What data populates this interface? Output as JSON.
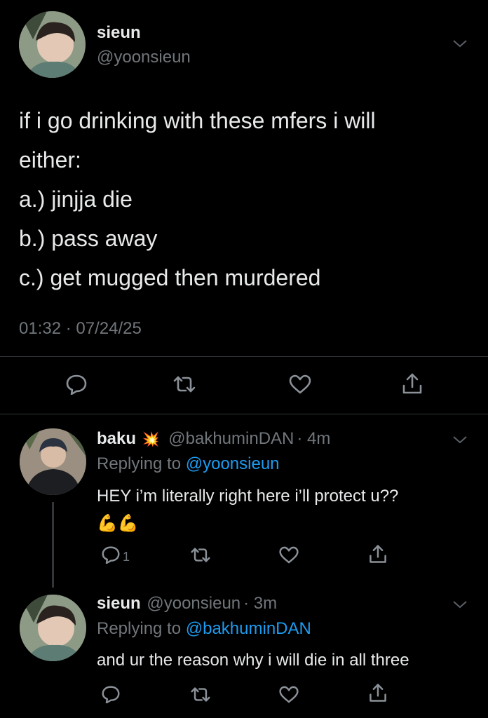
{
  "main_tweet": {
    "display_name": "sieun",
    "handle": "@yoonsieun",
    "lines": [
      "if i go drinking with these mfers i will",
      "either:",
      "a.) jinjja die",
      "b.) pass away",
      "c.) get mugged then murdered"
    ],
    "timestamp": "01:32 · 07/24/25"
  },
  "replies": [
    {
      "display_name": "baku",
      "badge_emoji": "💥",
      "handle": "@bakhuminDAN",
      "age": "· 4m",
      "replying_prefix": "Replying to",
      "replying_to": "@yoonsieun",
      "text": "HEY i’m literally right here i’ll protect u??",
      "emoji_line": "💪💪",
      "reply_count": "1"
    },
    {
      "display_name": "sieun",
      "handle": "@yoonsieun",
      "age": "· 3m",
      "replying_prefix": "Replying to",
      "replying_to": "@bakhuminDAN",
      "text": "and ur the reason why i will die in all three"
    }
  ],
  "icons": [
    "reply-icon",
    "retweet-icon",
    "like-icon",
    "share-icon",
    "chevron-down-icon"
  ],
  "colors": {
    "background": "#000000",
    "text": "#e7e9ea",
    "muted": "#71767b",
    "link": "#1d9bf0",
    "divider": "#2f3336"
  }
}
